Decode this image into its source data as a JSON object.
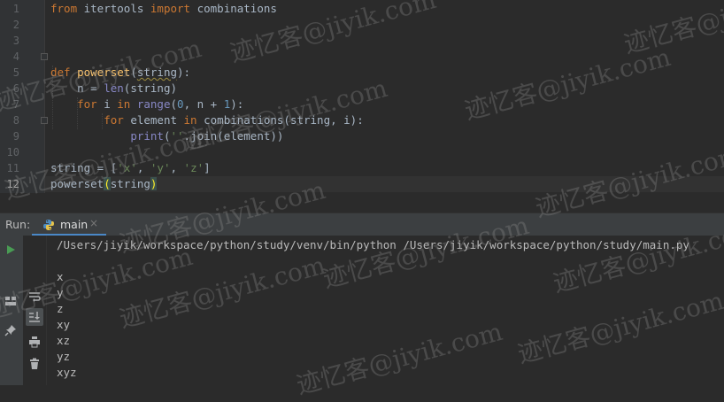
{
  "editor": {
    "line_numbers": [
      "1",
      "2",
      "3",
      "4",
      "5",
      "6",
      "7",
      "8",
      "9",
      "10",
      "11",
      "12"
    ],
    "lines": [
      {
        "tokens": [
          {
            "t": "from",
            "c": "kw"
          },
          {
            "t": " itertools "
          },
          {
            "t": "import",
            "c": "kw"
          },
          {
            "t": " combinations"
          }
        ]
      },
      {
        "tokens": []
      },
      {
        "tokens": []
      },
      {
        "tokens": []
      },
      {
        "tokens": [
          {
            "t": "def",
            "c": "kw"
          },
          {
            "t": " "
          },
          {
            "t": "powerset",
            "c": "fn"
          },
          {
            "t": "("
          },
          {
            "t": "string",
            "c": "squiggle"
          },
          {
            "t": "):"
          }
        ]
      },
      {
        "tokens": [
          {
            "t": "    n = "
          },
          {
            "t": "len",
            "c": "bi"
          },
          {
            "t": "(string)"
          }
        ]
      },
      {
        "tokens": [
          {
            "t": "    "
          },
          {
            "t": "for",
            "c": "kw"
          },
          {
            "t": " i "
          },
          {
            "t": "in",
            "c": "kw"
          },
          {
            "t": " "
          },
          {
            "t": "range",
            "c": "bi"
          },
          {
            "t": "("
          },
          {
            "t": "0",
            "c": "num"
          },
          {
            "t": ", n + "
          },
          {
            "t": "1",
            "c": "num"
          },
          {
            "t": "):"
          }
        ]
      },
      {
        "tokens": [
          {
            "t": "        "
          },
          {
            "t": "for",
            "c": "kw"
          },
          {
            "t": " element "
          },
          {
            "t": "in",
            "c": "kw"
          },
          {
            "t": " combinations(string, i):"
          }
        ]
      },
      {
        "tokens": [
          {
            "t": "            "
          },
          {
            "t": "print",
            "c": "bi"
          },
          {
            "t": "("
          },
          {
            "t": "''",
            "c": "str"
          },
          {
            "t": ".join(element))"
          }
        ]
      },
      {
        "tokens": []
      },
      {
        "tokens": [
          {
            "t": "string = ["
          },
          {
            "t": "'x'",
            "c": "str"
          },
          {
            "t": ", "
          },
          {
            "t": "'y'",
            "c": "str"
          },
          {
            "t": ", "
          },
          {
            "t": "'z'",
            "c": "str"
          },
          {
            "t": "]"
          }
        ]
      },
      {
        "tokens": [
          {
            "t": "powerset"
          },
          {
            "t": "(",
            "c": "paren-hl"
          },
          {
            "t": "string"
          },
          {
            "t": ")",
            "c": "paren-hl"
          }
        ]
      }
    ],
    "active_line": 12
  },
  "run_panel": {
    "label": "Run:",
    "tab_label": "main",
    "tab_close": "×",
    "command": "/Users/jiyik/workspace/python/study/venv/bin/python /Users/jiyik/workspace/python/study/main.py",
    "output": [
      "x",
      "y",
      "z",
      "xy",
      "xz",
      "yz",
      "xyz"
    ]
  },
  "watermark": "迹忆客@jiyik.com",
  "colors": {
    "accent": "#4a88c7",
    "run_green": "#499c54",
    "keyword": "#cc7832",
    "function": "#ffc66d"
  }
}
